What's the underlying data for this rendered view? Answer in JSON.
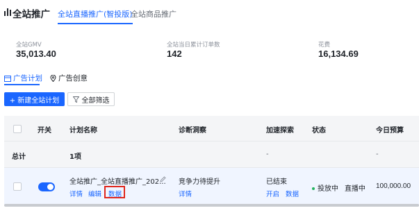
{
  "header": {
    "title": "全站推广",
    "tabs": [
      {
        "label": "全站直播推广(智投版)",
        "active": true
      },
      {
        "label": "全站商品推广",
        "active": false
      }
    ]
  },
  "stats": [
    {
      "label": "全站GMV",
      "value": "35,013.40"
    },
    {
      "label": "全站当日累计订单数",
      "value": "142"
    },
    {
      "label": "花费",
      "value": "16,134.69"
    }
  ],
  "sub_tabs": [
    {
      "label": "广告计划",
      "icon": "calendar-icon",
      "active": true
    },
    {
      "label": "广告创意",
      "icon": "location-pin-icon",
      "active": false
    }
  ],
  "toolbar": {
    "new_plan_label": "+ 新建全站计划",
    "filter_label": "全部筛选"
  },
  "table": {
    "headers": {
      "switch": "开关",
      "name": "计划名称",
      "diagnosis": "诊断洞察",
      "explore": "加速探索",
      "status": "状态",
      "budget": "今日预算"
    },
    "summary": {
      "label": "总计",
      "count": "1项",
      "explore": "-",
      "budget": "-"
    },
    "rows": [
      {
        "enabled": true,
        "name": "全站推广_全站直播推广_202...",
        "actions": [
          "详情",
          "编辑",
          "数据"
        ],
        "diagnosis": "竞争力待提升",
        "diagnosis_link": "详情",
        "explore_status": "已结束",
        "explore_actions": [
          "开启",
          "数据"
        ],
        "status": "投放中",
        "live_status": "直播中",
        "budget": "100,000.00"
      }
    ]
  },
  "colors": {
    "accent": "#1a66ff",
    "highlight": "#e0251b",
    "status_active": "#22b35e"
  }
}
